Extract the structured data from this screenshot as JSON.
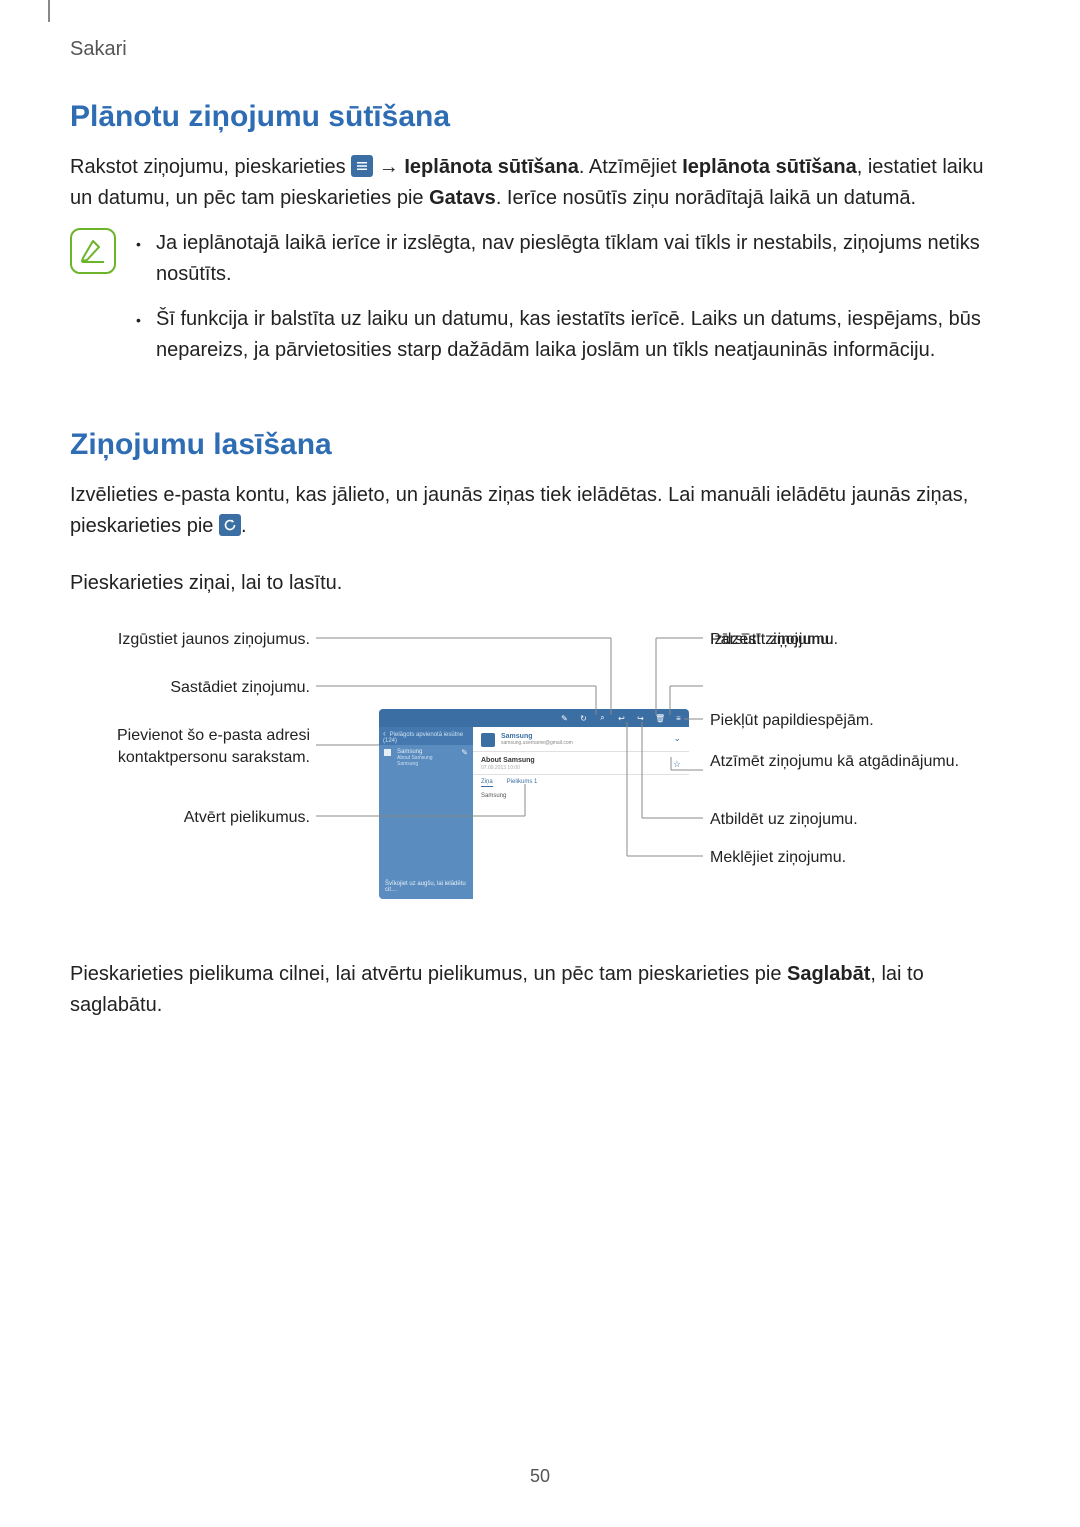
{
  "header": {
    "section": "Sakari"
  },
  "page_number": "50",
  "s1": {
    "heading": "Plānotu ziņojumu sūtīšana",
    "p1a": "Rakstot ziņojumu, pieskarieties ",
    "p1b": " → ",
    "p1_bold1": "Ieplānota sūtīšana",
    "p1c": ". Atzīmējiet ",
    "p1_bold2": "Ieplānota sūtīšana",
    "p1d": ", iestatiet laiku un datumu, un pēc tam pieskarieties pie ",
    "p1_bold3": "Gatavs",
    "p1e": ". Ierīce nosūtīs ziņu norādītajā laikā un datumā.",
    "note1": "Ja ieplānotajā laikā ierīce ir izslēgta, nav pieslēgta tīklam vai tīkls ir nestabils, ziņojums netiks nosūtīts.",
    "note2": "Šī funkcija ir balstīta uz laiku un datumu, kas iestatīts ierīcē. Laiks un datums, iespējams, būs nepareizs, ja pārvietosities starp dažādām laika joslām un tīkls neatjauninās informāciju."
  },
  "s2": {
    "heading": "Ziņojumu lasīšana",
    "p1a": "Izvēlieties e-pasta kontu, kas jālieto, un jaunās ziņas tiek ielādētas. Lai manuāli ielādētu jaunās ziņas, pieskarieties pie ",
    "p1b": ".",
    "p2": "Pieskarieties ziņai, lai to lasītu.",
    "p3a": "Pieskarieties pielikuma cilnei, lai atvērtu pielikumus, un pēc tam pieskarieties pie ",
    "p3_bold": "Saglabāt",
    "p3b": ", lai to saglabātu."
  },
  "labels": {
    "l1": "Izgūstiet jaunos ziņojumus.",
    "l2": "Sastādiet ziņojumu.",
    "l3": "Pievienot šo e-pasta adresi kontaktpersonu sarakstam.",
    "l4": "Atvērt pielikumus.",
    "r1": "Pārsūtīt ziņojumu.",
    "r2": "Izdzēst ziņojumu.",
    "r3": "Piekļūt papildiespējām.",
    "r4": "Atzīmēt ziņojumu kā atgādinājumu.",
    "r5": "Atbildēt uz ziņojumu.",
    "r6": "Meklējiet ziņojumu."
  },
  "sc": {
    "inbox_label": "Pielāgots apvienotā iesūtne (124)",
    "item_title": "Samsung",
    "item_sub": "About Samsung",
    "item_sub2": "Samsung",
    "bottom": "Švīkojiet uz augšu, lai ielādētu cit…",
    "sender": "Samsung",
    "email": "samsung.username@gmail.com",
    "subject": "About Samsung",
    "date": "07.09.2013 10:00",
    "tab1": "Ziņa",
    "tab2": "Pielikums 1",
    "body": "Samsung"
  }
}
